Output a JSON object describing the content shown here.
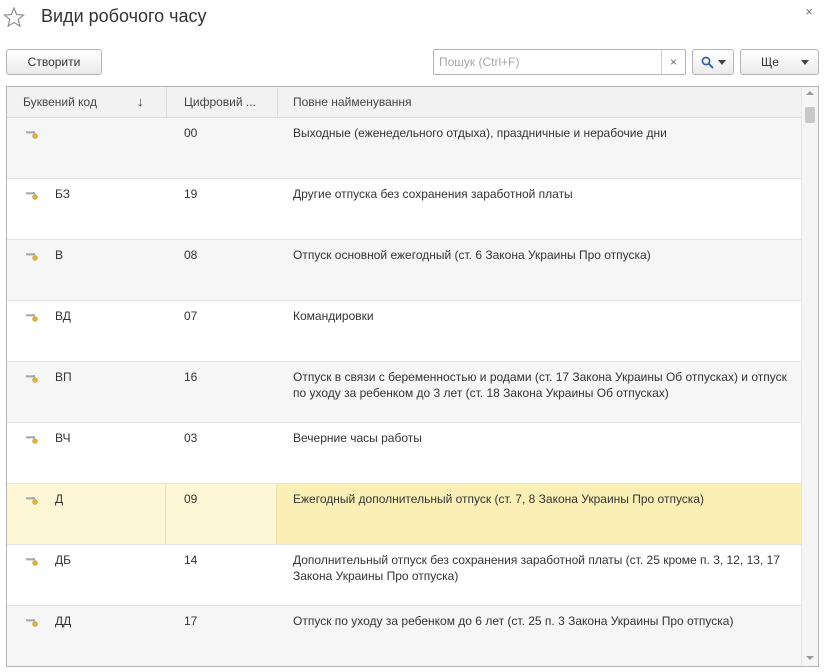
{
  "window": {
    "title": "Види робочого часу",
    "close_glyph": "×",
    "star_icon": "star-icon"
  },
  "toolbar": {
    "create_label": "Створити",
    "search_placeholder": "Пошук (Ctrl+F)",
    "search_value": "",
    "clear_glyph": "×",
    "more_label": "Ще"
  },
  "table": {
    "columns": [
      {
        "key": "letter",
        "label": "Буквений код",
        "sort_indicator": "↓"
      },
      {
        "key": "num",
        "label": "Цифровий ..."
      },
      {
        "key": "name",
        "label": "Повне найменування"
      }
    ],
    "rows": [
      {
        "letter": "",
        "num": "00",
        "name": "Выходные (еженедельного отдыха), праздничные и нерабочие дни"
      },
      {
        "letter": "БЗ",
        "num": "19",
        "name": "Другие отпуска без сохранения заработной платы"
      },
      {
        "letter": "В",
        "num": "08",
        "name": "Отпуск основной ежегодный (ст. 6 Закона Украины Про отпуска)"
      },
      {
        "letter": "ВД",
        "num": "07",
        "name": "Командировки"
      },
      {
        "letter": "ВП",
        "num": "16",
        "name": "Отпуск в связи с беременностью и родами (ст. 17 Закона Украины Об отпусках) и отпуск по уходу за ребенком до 3 лет (ст. 18 Закона Украины Об отпусках)"
      },
      {
        "letter": "ВЧ",
        "num": "03",
        "name": "Вечерние часы работы"
      },
      {
        "letter": "Д",
        "num": "09",
        "name": "Ежегодный дополнительный отпуск (ст. 7, 8 Закона Украины Про отпуска)"
      },
      {
        "letter": "ДБ",
        "num": "14",
        "name": "Дополнительный отпуск без сохранения заработной платы (ст. 25 кроме п. 3, 12, 13, 17 Закона Украины Про отпуска)"
      },
      {
        "letter": "ДД",
        "num": "17",
        "name": "Отпуск по уходу за ребенком до 6 лет (ст. 25 п. 3 Закона Украины Про отпуска)"
      }
    ],
    "selected_row_index": 6,
    "row_icon": "catalog-item-icon"
  },
  "colors": {
    "selected_row": "#faf0b6",
    "selected_row_cells": "#fdf7d6",
    "header_bg": "#f2f2f2",
    "border": "#b4b4b4"
  }
}
